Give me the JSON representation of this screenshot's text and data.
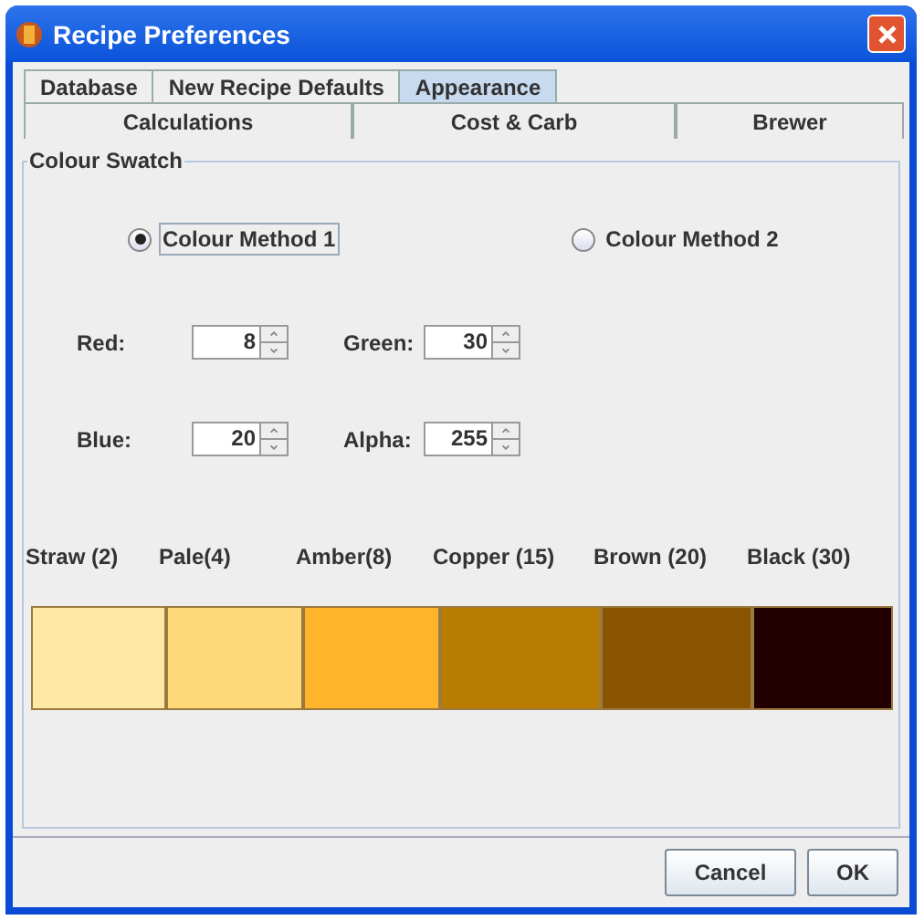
{
  "window": {
    "title": "Recipe Preferences"
  },
  "tab_rows": [
    [
      {
        "label": "Database",
        "selected": false
      },
      {
        "label": "New Recipe Defaults",
        "selected": false
      },
      {
        "label": "Appearance",
        "selected": true
      }
    ],
    [
      {
        "label": "Calculations",
        "selected": false
      },
      {
        "label": "Cost & Carb",
        "selected": false
      },
      {
        "label": "Brewer",
        "selected": false
      }
    ]
  ],
  "group": {
    "title": "Colour Swatch"
  },
  "methods": [
    {
      "label": "Colour Method 1",
      "selected": true
    },
    {
      "label": "Colour Method 2",
      "selected": false
    }
  ],
  "spinners": [
    {
      "label": "Red:",
      "value": "8"
    },
    {
      "label": "Green:",
      "value": "30"
    },
    {
      "label": "Blue:",
      "value": "20"
    },
    {
      "label": "Alpha:",
      "value": "255"
    }
  ],
  "swatches": [
    {
      "label": "Straw (2)",
      "color": "#ffe8a4"
    },
    {
      "label": "Pale(4)",
      "color": "#ffd877"
    },
    {
      "label": "Amber(8)",
      "color": "#ffb42a"
    },
    {
      "label": "Copper (15)",
      "color": "#b87d00"
    },
    {
      "label": "Brown (20)",
      "color": "#8a5500"
    },
    {
      "label": "Black (30)",
      "color": "#220000"
    }
  ],
  "buttons": [
    "Cancel",
    "OK"
  ]
}
